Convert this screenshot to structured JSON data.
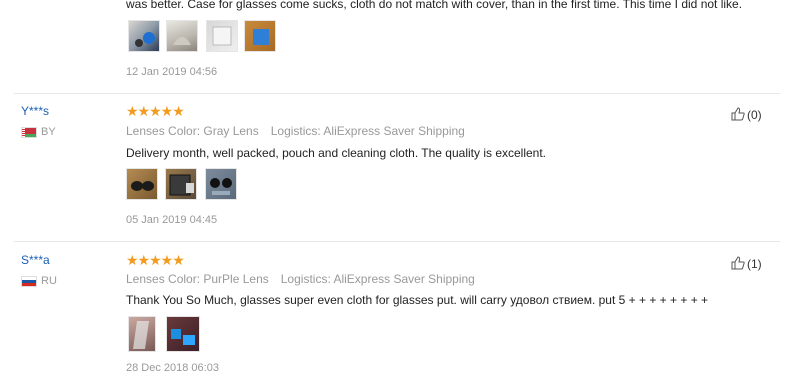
{
  "reviews": [
    {
      "text": "was better. Case for glasses come sucks, cloth do not match with cover, than in the first time. This time I did not like.",
      "date": "12 Jan 2019 04:56"
    },
    {
      "user": "Y***s",
      "country": "BY",
      "stars": "★★★★★",
      "color": "Lenses Color: Gray Lens",
      "logistics": "Logistics: AliExpress Saver Shipping",
      "text": "Delivery month, well packed, pouch and cleaning cloth. The quality is excellent.",
      "date": "05 Jan 2019 04:45",
      "helpful": "(0)"
    },
    {
      "user": "S***a",
      "country": "RU",
      "stars": "★★★★★",
      "color": "Lenses Color: PurPle Lens",
      "logistics": "Logistics: AliExpress Saver Shipping",
      "text": "Thank You So Much, glasses super even cloth for glasses put. will carry удовол ствием. put 5 + + + + + + + +",
      "date": "28 Dec 2018 06:03",
      "helpful": "(1)"
    }
  ],
  "colors": {
    "star": "#f29c1f",
    "username": "#1a5fb4",
    "meta": "#999999"
  }
}
